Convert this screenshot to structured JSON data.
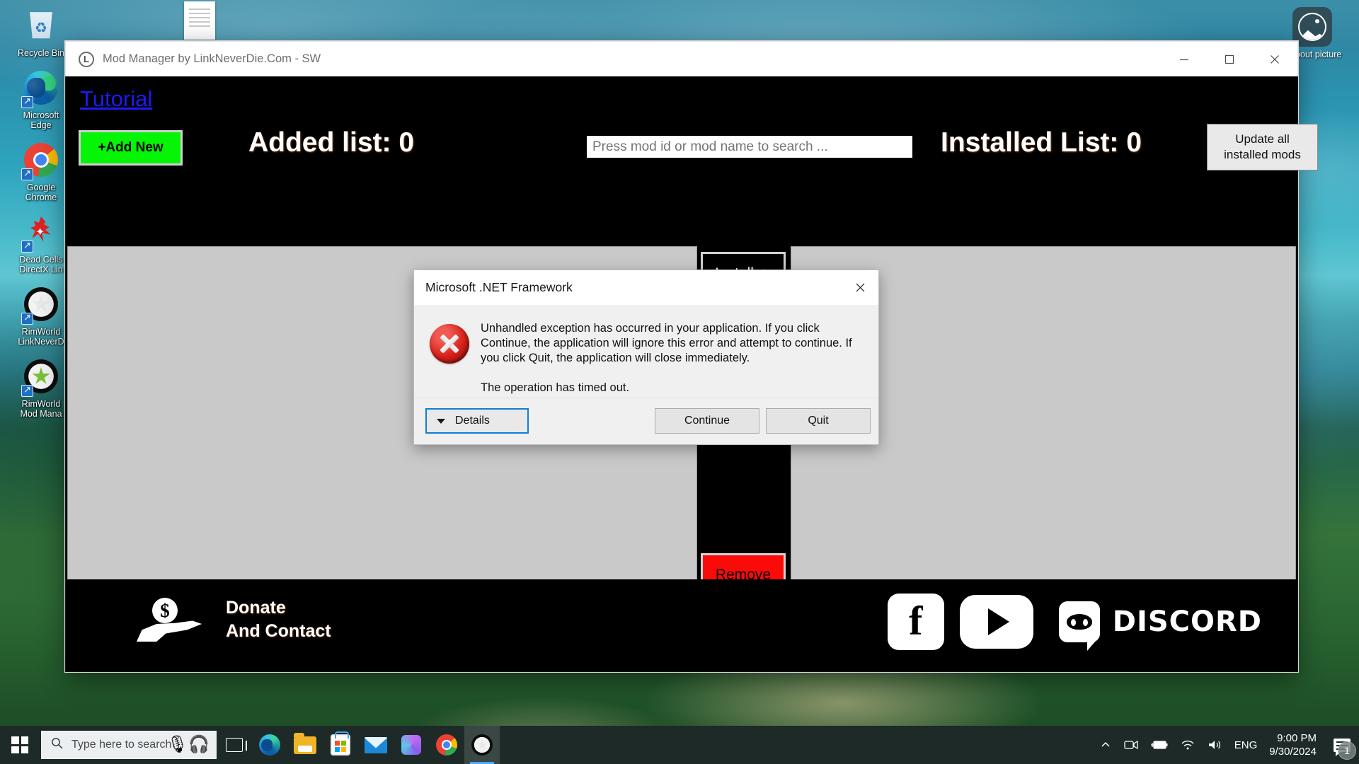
{
  "desktop": {
    "icons": [
      {
        "name": "recycle-bin",
        "label": "Recycle Bin",
        "kind": "recycle"
      },
      {
        "name": "microsoft-edge",
        "label": "Microsoft\nEdge",
        "kind": "edge"
      },
      {
        "name": "google-chrome",
        "label": "Google\nChrome",
        "kind": "chrome"
      },
      {
        "name": "dead-cells-directx",
        "label": "Dead Cells\nDirectX Lin",
        "kind": "flame"
      },
      {
        "name": "rimworld-linkneverdie",
        "label": "RimWorld\nLinkNeverD",
        "kind": "rim"
      },
      {
        "name": "rimworld-mod-manager",
        "label": "RimWorld\nMod Mana",
        "kind": "rim-green"
      }
    ],
    "photos_tile_label": "n about\npicture"
  },
  "window": {
    "title": "Mod Manager by LinkNeverDie.Com - SW",
    "icon_letter": "L",
    "minimize_label": "Minimize",
    "maximize_label": "Maximize",
    "close_label": "Close"
  },
  "app": {
    "tutorial_link": "Tutorial",
    "add_new_label": "+Add New",
    "added_list_label": "Added list: 0",
    "search_placeholder": "Press mod id or mod name to search ...",
    "search_value": "",
    "installed_list_label": "Installed List: 0",
    "update_all_line1": "Update all",
    "update_all_line2": "installed mods",
    "install_label": "Install ->",
    "remove_label": "Remove",
    "colors": {
      "add_new_bg": "#06f406",
      "remove_bg": "#fb0a0a",
      "panel_bg": "#c9c9c9",
      "app_bg": "#000000",
      "tutorial_link": "#1b1bf5"
    }
  },
  "footer": {
    "donate_line1": "Donate",
    "donate_line2": "And Contact",
    "donate_icon": "hand-with-coin-icon",
    "facebook_label": "f",
    "youtube_label": "play",
    "discord_label": "DISCORD"
  },
  "dialog": {
    "title": "Microsoft .NET Framework",
    "icon": "error-icon",
    "message_paragraph_1": "Unhandled exception has occurred in your application. If you click Continue, the application will ignore this error and attempt to continue. If you click Quit, the application will close immediately.",
    "message_paragraph_2": "The operation has timed out.",
    "details_label": "Details",
    "continue_label": "Continue",
    "quit_label": "Quit",
    "close_label": "Close",
    "focus_color": "#0f7fd4"
  },
  "taskbar": {
    "start_label": "Start",
    "search_placeholder": "Type here to search",
    "task_view_label": "Task View",
    "apps": [
      {
        "name": "microsoft-edge",
        "kind": "edge",
        "active": false
      },
      {
        "name": "file-explorer",
        "kind": "folder",
        "active": false
      },
      {
        "name": "microsoft-store",
        "kind": "store",
        "active": false
      },
      {
        "name": "mail",
        "kind": "mail",
        "active": false
      },
      {
        "name": "office",
        "kind": "office",
        "active": false
      },
      {
        "name": "google-chrome",
        "kind": "chrome",
        "active": false
      },
      {
        "name": "rimworld-mod-manager",
        "kind": "rim",
        "active": true
      }
    ],
    "tray": {
      "show_hidden_label": "Show hidden icons",
      "camera_label": "Camera",
      "battery_label": "Battery",
      "network_label": "Network",
      "volume_label": "Volume",
      "language": "ENG",
      "time": "9:00 PM",
      "date": "9/30/2024",
      "notification_count": "1"
    }
  }
}
